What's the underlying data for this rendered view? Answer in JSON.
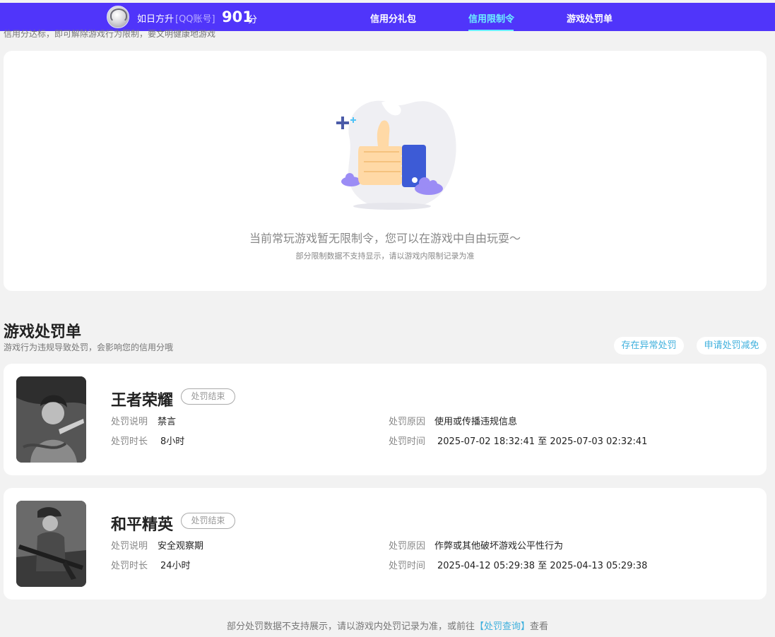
{
  "header": {
    "username": "如日方升",
    "account_type": "[QQ账号]",
    "score": "901",
    "score_unit": "分",
    "tabs": [
      {
        "label": "信用分礼包",
        "active": false
      },
      {
        "label": "信用限制令",
        "active": true
      },
      {
        "label": "游戏处罚单",
        "active": false
      }
    ],
    "active_color": "#6cf0ff",
    "bar_color": "#5035fa"
  },
  "partial_text": "信用分达标，即可解除游戏行为限制，要文明健康地游戏",
  "restriction": {
    "empty_title": "当前常玩游戏暂无限制令，您可以在游戏中自由玩耍～",
    "empty_subtitle": "部分限制数据不支持显示，请以游戏内限制记录为准"
  },
  "penalty_section": {
    "title": "游戏处罚单",
    "subtitle": "游戏行为违规导致处罚，会影响您的信用分哦",
    "buttons": [
      "存在异常处罚",
      "申请处罚减免"
    ],
    "items": [
      {
        "game": "王者荣耀",
        "status": "处罚结束",
        "desc_label": "处罚说明",
        "desc": "禁言",
        "duration_label": "处罚时长",
        "duration": "8小时",
        "reason_label": "处罚原因",
        "reason": "使用或传播违规信息",
        "time_label": "处罚时间",
        "time": "2025-07-02 18:32:41 至 2025-07-03 02:32:41"
      },
      {
        "game": "和平精英",
        "status": "处罚结束",
        "desc_label": "处罚说明",
        "desc": "安全观察期",
        "duration_label": "处罚时长",
        "duration": "24小时",
        "reason_label": "处罚原因",
        "reason": "作弊或其他破坏游戏公平性行为",
        "time_label": "处罚时间",
        "time": "2025-04-12 05:29:38 至 2025-04-13 05:29:38"
      }
    ]
  },
  "footer": {
    "prefix": "部分处罚数据不支持展示，请以游戏内处罚记录为准，或前往",
    "link": "【处罚查询】",
    "suffix": "查看"
  }
}
